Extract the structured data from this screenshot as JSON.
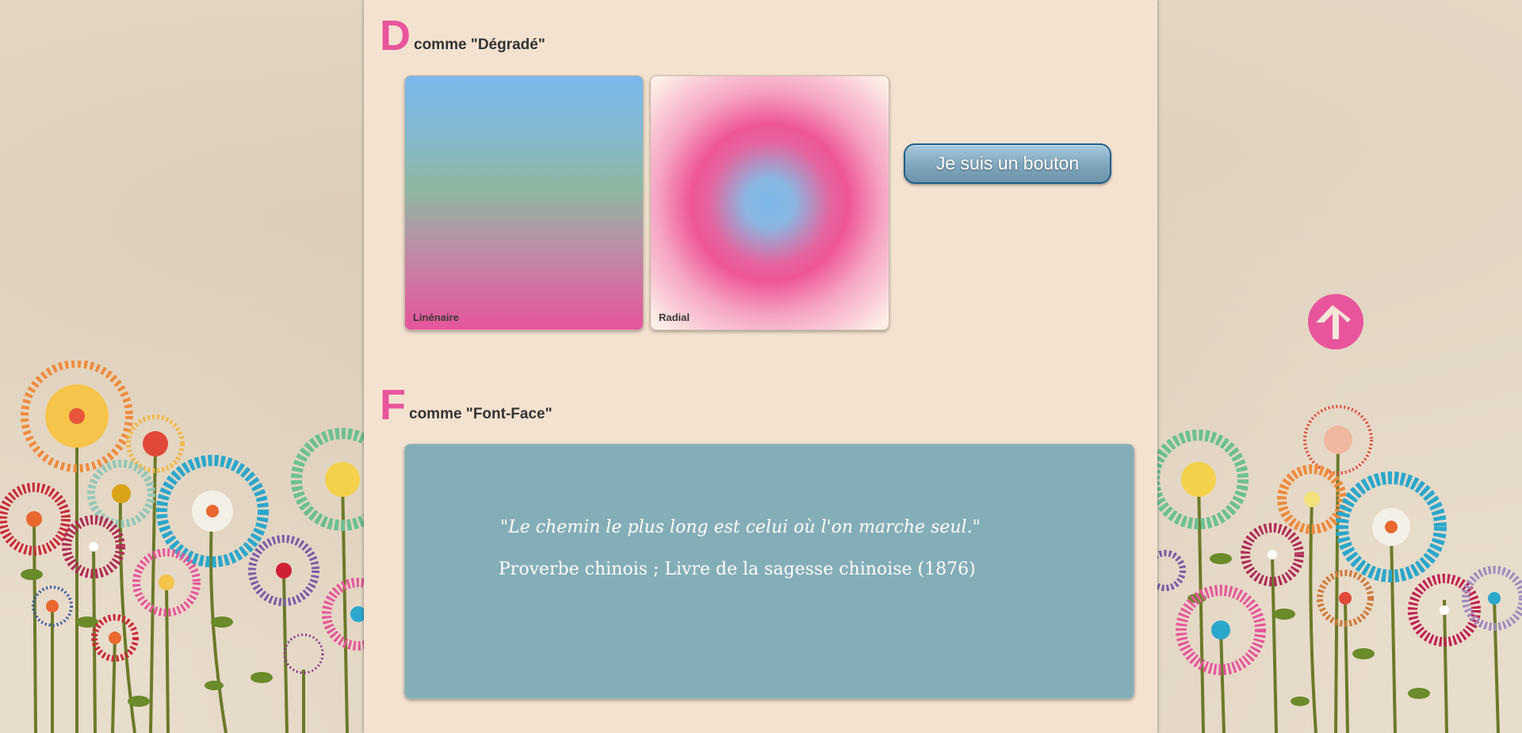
{
  "sections": {
    "degrade": {
      "letter": "D",
      "title": "comme \"Dégradé\"",
      "linear_label": "Linénaire",
      "radial_label": "Radial",
      "button_label": "Je suis un bouton"
    },
    "fontface": {
      "letter": "F",
      "title": "comme \"Font-Face\"",
      "quote": "\"Le chemin le plus long est celui où l'on marche seul.\"",
      "source": "Proverbe chinois ; Livre de la sagesse chinoise (1876)"
    }
  },
  "colors": {
    "accent": "#e8559c",
    "column_bg": "#f4e2d0",
    "quote_bg": "#84aeb7",
    "button_border": "#1f5d8a"
  },
  "icons": {
    "back_to_top": "arrow-up-icon"
  }
}
